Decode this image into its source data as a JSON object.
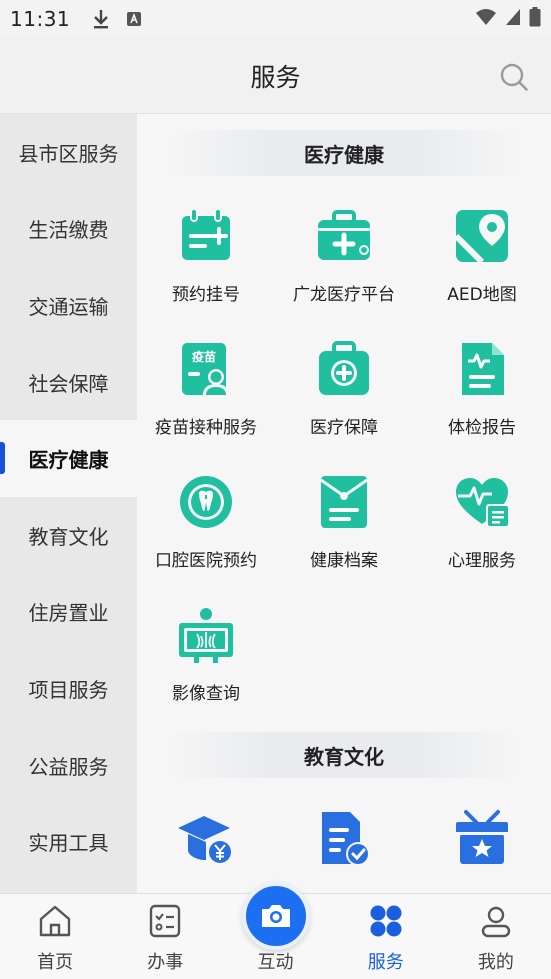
{
  "status_bar": {
    "time": "11:31"
  },
  "header": {
    "title": "服务"
  },
  "sidebar": {
    "items": [
      {
        "label": "县市区服务"
      },
      {
        "label": "生活缴费"
      },
      {
        "label": "交通运输"
      },
      {
        "label": "社会保障"
      },
      {
        "label": "医疗健康",
        "active": true
      },
      {
        "label": "教育文化"
      },
      {
        "label": "住房置业"
      },
      {
        "label": "项目服务"
      },
      {
        "label": "公益服务"
      },
      {
        "label": "实用工具"
      }
    ]
  },
  "main": {
    "sections": [
      {
        "title": "医疗健康",
        "items": [
          {
            "label": "预约挂号",
            "icon": "calendar-plus-icon"
          },
          {
            "label": "广龙医疗平台",
            "icon": "medical-kit-icon"
          },
          {
            "label": "AED地图",
            "icon": "map-pin-icon"
          },
          {
            "label": "疫苗接种服务",
            "icon": "vaccine-card-icon"
          },
          {
            "label": "医疗保障",
            "icon": "first-aid-icon"
          },
          {
            "label": "体检报告",
            "icon": "report-pulse-icon"
          },
          {
            "label": "口腔医院预约",
            "icon": "tooth-icon"
          },
          {
            "label": "健康档案",
            "icon": "file-folder-icon"
          },
          {
            "label": "心理服务",
            "icon": "heart-pulse-icon"
          },
          {
            "label": "影像查询",
            "icon": "xray-icon"
          }
        ]
      },
      {
        "title": "教育文化",
        "items": [
          {
            "icon": "graduation-cap-yen-icon"
          },
          {
            "icon": "document-check-icon"
          },
          {
            "icon": "gift-star-icon"
          }
        ]
      }
    ],
    "icon_color": "#1fbf9f",
    "edu_icon_color": "#2a6fe0"
  },
  "bottom_nav": {
    "items": [
      {
        "label": "首页",
        "icon": "home-icon"
      },
      {
        "label": "办事",
        "icon": "checklist-icon"
      },
      {
        "label": "互动",
        "icon": "camera-icon"
      },
      {
        "label": "服务",
        "icon": "apps-icon",
        "active": true
      },
      {
        "label": "我的",
        "icon": "user-icon"
      }
    ]
  }
}
